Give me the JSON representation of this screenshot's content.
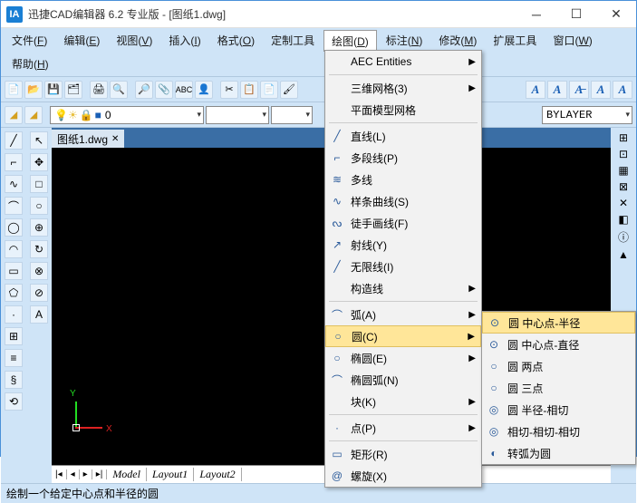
{
  "window": {
    "title": "迅捷CAD编辑器 6.2 专业版  -  [图纸1.dwg]",
    "logo": "IA"
  },
  "menubar": [
    {
      "l": "文件",
      "k": "F"
    },
    {
      "l": "编辑",
      "k": "E"
    },
    {
      "l": "视图",
      "k": "V"
    },
    {
      "l": "插入",
      "k": "I"
    },
    {
      "l": "格式",
      "k": "O"
    },
    {
      "l": "定制工具",
      "k": ""
    },
    {
      "l": "绘图",
      "k": "D"
    },
    {
      "l": "标注",
      "k": "N"
    },
    {
      "l": "修改",
      "k": "M"
    },
    {
      "l": "扩展工具",
      "k": ""
    },
    {
      "l": "窗口",
      "k": "W"
    },
    {
      "l": "帮助",
      "k": "H"
    }
  ],
  "filetab": {
    "name": "图纸1.dwg"
  },
  "bottomtabs": [
    "Model",
    "Layout1",
    "Layout2"
  ],
  "bylayer": "BYLAYER",
  "status": "绘制一个给定中心点和半径的圆",
  "drawmenu": [
    {
      "t": "item",
      "l": "AEC Entities",
      "sub": true
    },
    {
      "t": "sep"
    },
    {
      "t": "item",
      "l": "三维网格(3)",
      "sub": true
    },
    {
      "t": "item",
      "l": "平面模型网格",
      "sub": false
    },
    {
      "t": "sep"
    },
    {
      "t": "item",
      "ic": "╱",
      "l": "直线(L)"
    },
    {
      "t": "item",
      "ic": "⌐",
      "l": "多段线(P)"
    },
    {
      "t": "item",
      "ic": "≋",
      "l": "多线"
    },
    {
      "t": "item",
      "ic": "∿",
      "l": "样条曲线(S)"
    },
    {
      "t": "item",
      "ic": "ᔓ",
      "l": "徒手画线(F)"
    },
    {
      "t": "item",
      "ic": "↗",
      "l": "射线(Y)"
    },
    {
      "t": "item",
      "ic": "╱",
      "l": "无限线(I)"
    },
    {
      "t": "item",
      "l": "构造线",
      "sub": true
    },
    {
      "t": "sep"
    },
    {
      "t": "item",
      "ic": "⌒",
      "l": "弧(A)",
      "sub": true
    },
    {
      "t": "item",
      "ic": "○",
      "l": "圆(C)",
      "sub": true,
      "hl": true
    },
    {
      "t": "item",
      "ic": "○",
      "l": "椭圆(E)",
      "sub": true
    },
    {
      "t": "item",
      "ic": "⌒",
      "l": "椭圆弧(N)"
    },
    {
      "t": "item",
      "l": "块(K)",
      "sub": true
    },
    {
      "t": "sep"
    },
    {
      "t": "item",
      "ic": "·",
      "l": "点(P)",
      "sub": true
    },
    {
      "t": "sep"
    },
    {
      "t": "item",
      "ic": "▭",
      "l": "矩形(R)"
    },
    {
      "t": "item",
      "ic": "@",
      "l": "螺旋(X)"
    }
  ],
  "circlemenu": [
    {
      "ic": "⊙",
      "l": "圆 中心点-半径",
      "hl": true
    },
    {
      "ic": "⊙",
      "l": "圆 中心点-直径"
    },
    {
      "ic": "○",
      "l": "圆 两点"
    },
    {
      "ic": "○",
      "l": "圆 三点"
    },
    {
      "ic": "◎",
      "l": "圆 半径-相切"
    },
    {
      "ic": "◎",
      "l": "相切-相切-相切"
    },
    {
      "ic": "◐",
      "l": "转弧为圆"
    }
  ],
  "lefttools": [
    "╱",
    "⌐",
    "∿",
    "⌒",
    "◯",
    "◠",
    "▭",
    "⬠",
    "·",
    "⊞",
    "≡",
    "§",
    "⟲"
  ],
  "lefttools2": [
    "↖",
    "✥",
    "□",
    "○",
    "⊕",
    "↻",
    "⊗",
    "⊘",
    "A"
  ],
  "righttools": [
    "⊞",
    "⊡",
    "▦",
    "⊠",
    "✕",
    "◧",
    "ⓘ",
    "▲"
  ],
  "axis": {
    "x": "X",
    "y": "Y"
  }
}
